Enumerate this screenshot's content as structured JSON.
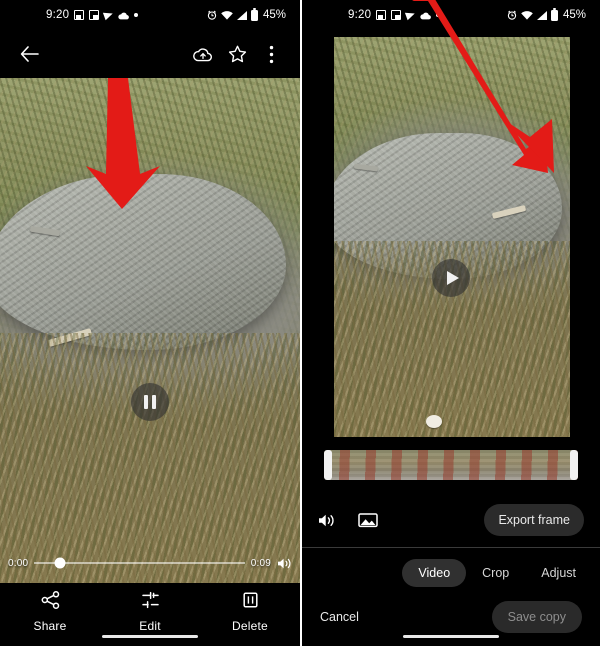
{
  "status_bar": {
    "time": "9:20",
    "battery_percent": "45%",
    "left_icons": [
      "save-icon",
      "picture-in-picture-icon",
      "send-icon",
      "cloud-upload-icon",
      "dot-icon"
    ],
    "right_icons": [
      "alarm-icon",
      "wifi-icon",
      "signal-icon",
      "battery-icon"
    ]
  },
  "left_screen": {
    "name": "photo-viewer",
    "appbar": {
      "back_label": "Back",
      "icons": [
        "cloud-backup-icon",
        "star-icon",
        "overflow-menu-icon"
      ]
    },
    "player": {
      "state_icon": "pause-icon",
      "current_time": "0:00",
      "total_time": "0:09",
      "volume_icon": "volume-on-icon",
      "progress_percent": 12
    },
    "bottom_nav": [
      {
        "label": "Share",
        "icon": "share-icon"
      },
      {
        "label": "Edit",
        "icon": "tune-icon"
      },
      {
        "label": "Delete",
        "icon": "delete-icon"
      }
    ],
    "annotation": {
      "type": "red-arrow",
      "points_to": "Edit"
    }
  },
  "right_screen": {
    "name": "video-editor",
    "player": {
      "state_icon": "play-icon"
    },
    "timeline": {
      "name": "filmstrip-trimmer",
      "left_handle": true,
      "right_handle": true
    },
    "tools": {
      "volume_icon": "volume-on-icon",
      "frame_icon": "export-frame-icon",
      "export_frame_label": "Export frame"
    },
    "tabs": [
      {
        "label": "Video",
        "active": true
      },
      {
        "label": "Crop",
        "active": false
      },
      {
        "label": "Adjust",
        "active": false
      }
    ],
    "footer": {
      "cancel_label": "Cancel",
      "save_label": "Save copy",
      "save_enabled": false
    },
    "annotation": {
      "type": "red-arrow",
      "points_to": "Crop"
    }
  },
  "colors": {
    "annotation_red": "#e31b17",
    "background": "#000000",
    "active_tab_bg": "#303030",
    "disabled_text": "#8e8e8e"
  }
}
